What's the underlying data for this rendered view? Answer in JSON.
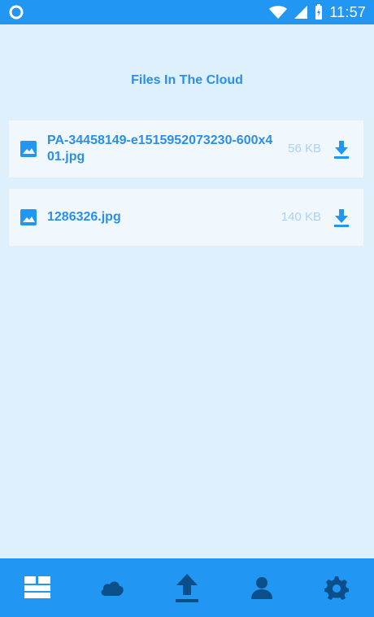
{
  "status_bar": {
    "time": "11:57",
    "icons": [
      "circle-icon",
      "wifi-icon",
      "signal-icon",
      "battery-icon"
    ]
  },
  "page": {
    "title": "Files In The Cloud"
  },
  "files": [
    {
      "name": "PA-34458149-e1515952073230-600x401.jpg",
      "size": "56 KB",
      "icon": "image-icon",
      "action_icon": "download-icon"
    },
    {
      "name": "1286326.jpg",
      "size": "140 KB",
      "icon": "image-icon",
      "action_icon": "download-icon"
    }
  ],
  "bottom_nav": {
    "items": [
      {
        "icon": "dashboard-icon"
      },
      {
        "icon": "cloud-icon"
      },
      {
        "icon": "upload-icon"
      },
      {
        "icon": "person-icon"
      },
      {
        "icon": "settings-icon"
      }
    ]
  },
  "colors": {
    "primary": "#2196f3",
    "background": "#dff0fd",
    "card": "#f0f8fe",
    "title": "#2b8fe8",
    "size_text": "#a8d2f7",
    "nav_icon_dark": "#0b4f8a",
    "nav_icon_light": "#ffffff"
  }
}
